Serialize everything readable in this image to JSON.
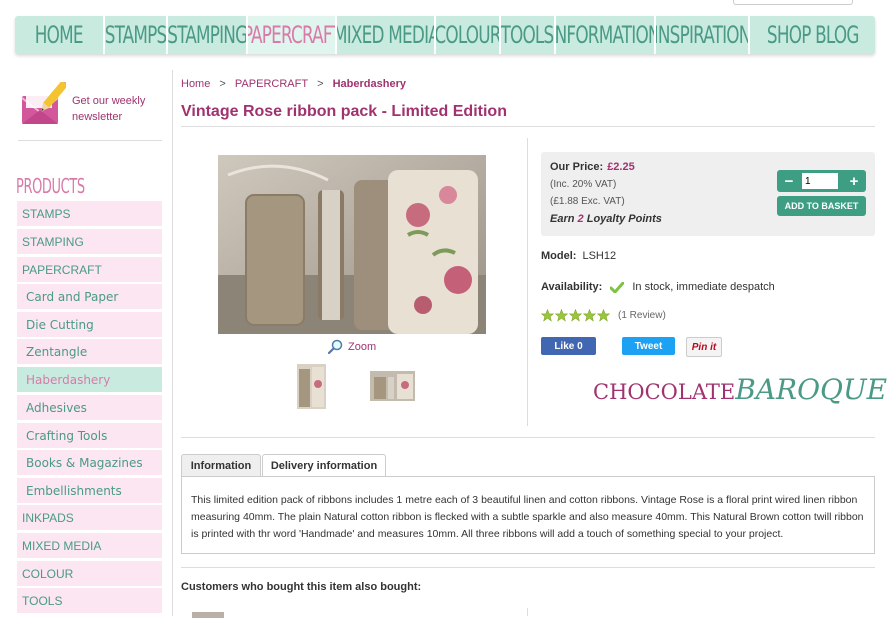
{
  "nav": {
    "items": [
      "HOME",
      "STAMPS",
      "STAMPING",
      "PAPERCRAFT",
      "MIXED MEDIA",
      "COLOUR",
      "TOOLS",
      "INFORMATION",
      "INSPIRATION",
      "SHOP BLOG"
    ],
    "active": "PAPERCRAFT"
  },
  "newsletter": {
    "text": "Get our weekly newsletter",
    "icon": "newsletter-envelope-pencil-icon"
  },
  "sidebar": {
    "title": "PRODUCTS",
    "items": [
      {
        "label": "STAMPS",
        "level": "top"
      },
      {
        "label": "STAMPING",
        "level": "top"
      },
      {
        "label": "PAPERCRAFT",
        "level": "top"
      },
      {
        "label": "Card and Paper",
        "level": "sub"
      },
      {
        "label": "Die Cutting",
        "level": "sub"
      },
      {
        "label": "Zentangle",
        "level": "sub"
      },
      {
        "label": "Haberdashery",
        "level": "sub",
        "active": true
      },
      {
        "label": "Adhesives",
        "level": "sub"
      },
      {
        "label": "Crafting Tools",
        "level": "sub"
      },
      {
        "label": "Books & Magazines",
        "level": "sub"
      },
      {
        "label": "Embellishments",
        "level": "sub"
      },
      {
        "label": "INKPADS",
        "level": "top"
      },
      {
        "label": "MIXED MEDIA",
        "level": "top"
      },
      {
        "label": "COLOUR",
        "level": "top"
      },
      {
        "label": "TOOLS",
        "level": "top"
      }
    ]
  },
  "breadcrumb": {
    "home": "Home",
    "sep": ">",
    "cat": "PAPERCRAFT",
    "current": "Haberdashery"
  },
  "product": {
    "title": "Vintage Rose ribbon pack - Limited Edition",
    "zoom_label": "Zoom",
    "price_label": "Our Price:",
    "price": "£2.25",
    "inc_vat": "(Inc. 20% VAT)",
    "exc_vat": "(£1.88 Exc. VAT)",
    "loyalty_prefix": "Earn",
    "loyalty_points": "2",
    "loyalty_suffix": "Loyalty Points",
    "quantity": "1",
    "minus": "−",
    "plus": "+",
    "add_to_basket": "ADD TO BASKET",
    "model_label": "Model:",
    "model": "LSH12",
    "availability_label": "Availability:",
    "availability": "In stock, immediate despatch",
    "rating": 5,
    "reviews": "(1 Review)",
    "like": "Like 0",
    "tweet": "Tweet",
    "pin": "Pin it",
    "brand_logo_text": {
      "part1": "CHOCOLATE",
      "part2": "BAROQUE"
    }
  },
  "tabs": {
    "items": [
      "Information",
      "Delivery information"
    ],
    "active": "Information",
    "info_text": "This limited edition pack of ribbons includes 1 metre each of 3 beautiful linen and cotton ribbons. Vintage Rose is a floral print wired linen ribbon measuring 40mm. The plain Natural cotton ribbon is flecked with a subtle sparkle and also measure 40mm. This Natural Brown cotton twill ribbon is printed with thr word 'Handmade' and measures 10mm. All three ribbons will add a touch of something special to your project."
  },
  "also_bought": "Customers who bought this item also bought:",
  "colors": {
    "accent_pink": "#a0336f",
    "nav_bg": "#c9ebdf",
    "nav_text": "#4a9a86",
    "sidebar_bg": "#fbe6f1",
    "button_green": "#3d9e83"
  }
}
